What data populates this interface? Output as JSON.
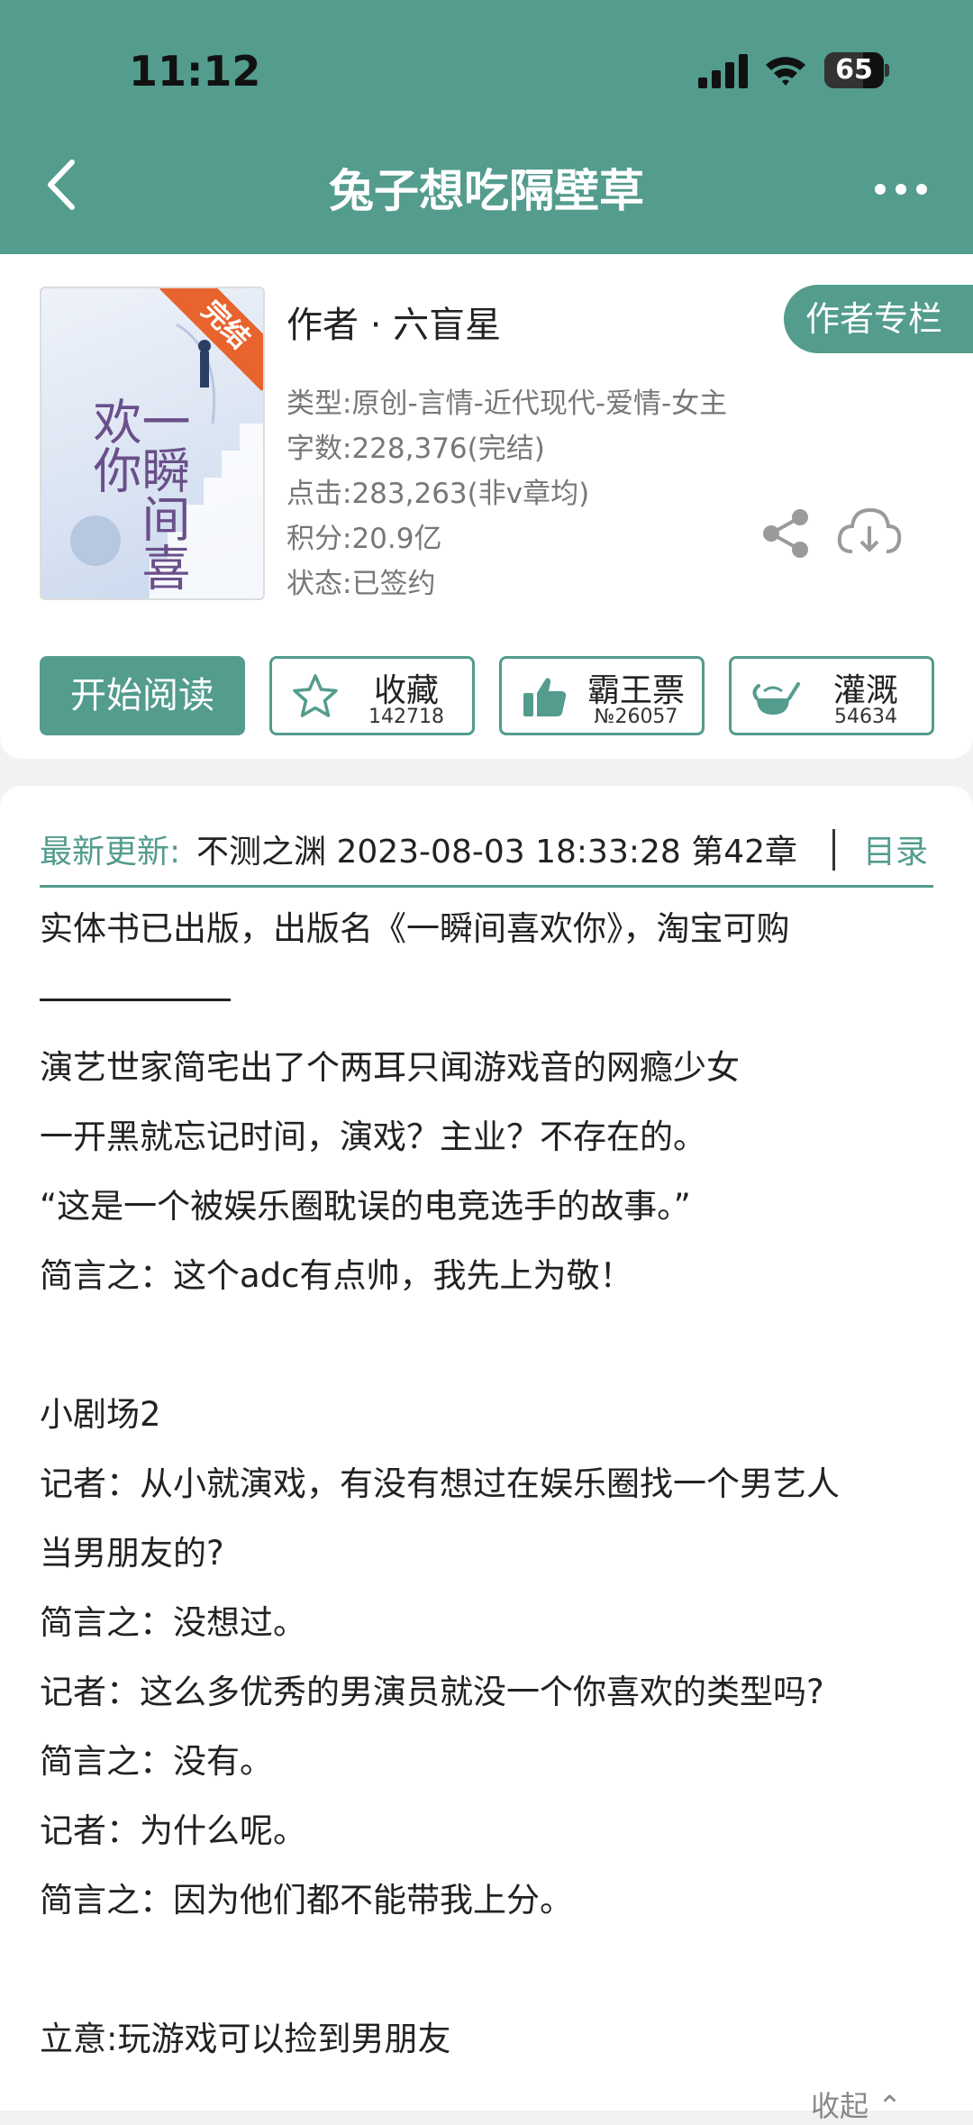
{
  "status_bar": {
    "time": "11:12",
    "battery": "65",
    "battery_level": 0.65
  },
  "nav": {
    "title": "兔子想吃隔壁草",
    "back_icon": "chevron-left-icon",
    "more_icon": "more-dots-icon"
  },
  "book": {
    "cover_badge": "完结",
    "cover_title": "一瞬间喜欢你",
    "author": "作者 · 六盲星",
    "author_column": "作者专栏",
    "type": "类型:原创-言情-近代现代-爱情-女主",
    "words": "字数:228,376(完结)",
    "clicks": "点击:283,263(非v章均)",
    "score": "积分:20.9亿",
    "status": "状态:已签约"
  },
  "actions": {
    "read": "开始阅读",
    "collect": {
      "label": "收藏",
      "count": "142718",
      "icon": "star-icon"
    },
    "ticket": {
      "label": "霸王票",
      "count": "№26057",
      "icon": "thumbs-up-icon"
    },
    "water": {
      "label": "灌溉",
      "count": "54634",
      "icon": "watering-can-icon"
    }
  },
  "update": {
    "label": "最新更新:",
    "text": "不测之渊 2023-08-03 18:33:28  第42章",
    "catalog": "目录"
  },
  "intro": {
    "line1": "实体书已出版，出版名《一瞬间喜欢你》，淘宝可购",
    "line3": "演艺世家简宅出了个两耳只闻游戏音的网瘾少女",
    "line4": "一开黑就忘记时间，演戏？主业？不存在的。",
    "line5": "“这是一个被娱乐圈耽误的电竞选手的故事。”",
    "line6": "简言之：这个adc有点帅，我先上为敬！",
    "line8": "小剧场2",
    "line9": "记者：从小就演戏，有没有想过在娱乐圈找一个男艺人",
    "line10": "当男朋友的?",
    "line11": "简言之：没想过。",
    "line12": "记者：这么多优秀的男演员就没一个你喜欢的类型吗?",
    "line13": "简言之：没有。",
    "line14": "记者：为什么呢。",
    "line15": "简言之：因为他们都不能带我上分。",
    "line17": "立意:玩游戏可以捡到男朋友"
  },
  "collapse": "收起 ⌃",
  "colors": {
    "theme": "#539c8e",
    "badge": "#e8632d"
  }
}
